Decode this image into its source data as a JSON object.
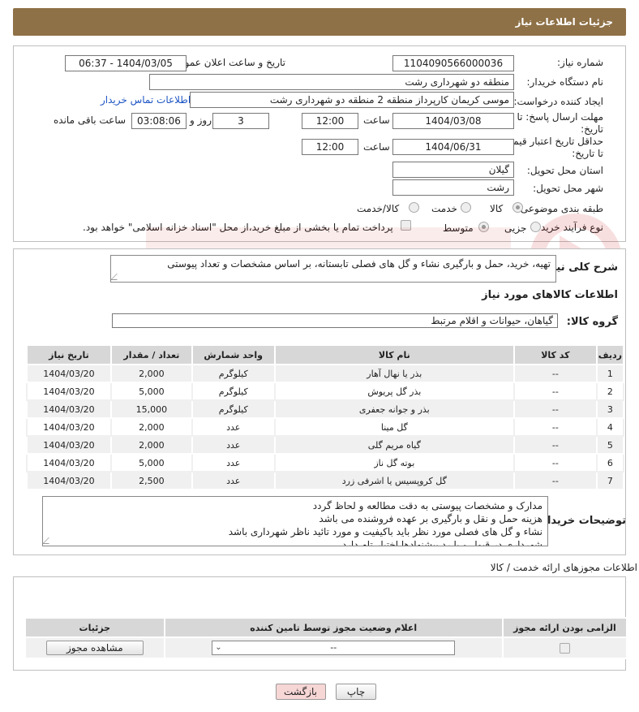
{
  "header": {
    "title": "جزئیات اطلاعات نیاز"
  },
  "form": {
    "need_number_label": "شماره نیاز:",
    "need_number": "1104090566000036",
    "announce_label": "تاریخ و ساعت اعلان عمومی:",
    "announce_value": "1404/03/05 - 06:37",
    "buyer_org_label": "نام دستگاه خریدار:",
    "buyer_org": "منطقه دو شهرداری رشت",
    "requester_label": "ایجاد کننده درخواست:",
    "requester": "موسی کریمان کارپرداز منطقه 2 منطقه دو شهرداری رشت",
    "contact_link": "اطلاعات تماس خریدار",
    "reply_deadline_label_1": "مهلت ارسال پاسخ: تا",
    "reply_deadline_label_2": "تاریخ:",
    "reply_date": "1404/03/08",
    "time_label": "ساعت",
    "reply_time": "12:00",
    "days_value": "3",
    "days_label": "روز و",
    "remaining_time": "03:08:06",
    "remaining_label": "ساعت باقی مانده",
    "price_validity_label_1": "حداقل تاریخ اعتبار قیمت:",
    "price_validity_label_2": "تا تاریخ:",
    "price_date": "1404/06/31",
    "price_time": "12:00",
    "province_label": "استان محل تحویل:",
    "province": "گیلان",
    "city_label": "شهر محل تحویل:",
    "city": "رشت",
    "category_label": "طبقه بندی موضوعی:",
    "category_options": [
      "کالا",
      "خدمت",
      "کالا/خدمت"
    ],
    "process_label": "نوع فرآیند خرید :",
    "process_options": [
      "جزیی",
      "متوسط"
    ],
    "treasury_note": "پرداخت تمام یا بخشی از مبلغ خرید،از محل \"اسناد خزانه اسلامی\" خواهد بود."
  },
  "description": {
    "label": "شرح کلی نیاز:",
    "text": "تهیه، خرید، حمل و بارگیری نشاء و گل های فصلی تابستانه، بر اساس مشخصات و تعداد پیوستی"
  },
  "goods": {
    "section_title": "اطلاعات کالاهای مورد نیاز",
    "group_label": "گروه کالا:",
    "group_value": "گیاهان، حیوانات و اقلام مرتبط",
    "columns": [
      "ردیف",
      "کد کالا",
      "نام کالا",
      "واحد شمارش",
      "تعداد / مقدار",
      "تاریخ نیاز"
    ],
    "rows": [
      [
        "1",
        "--",
        "بذر یا نهال آهار",
        "کیلوگرم",
        "2,000",
        "1404/03/20"
      ],
      [
        "2",
        "--",
        "بذر گل پریوش",
        "کیلوگرم",
        "5,000",
        "1404/03/20"
      ],
      [
        "3",
        "--",
        "بذر و جوانه جعفری",
        "کیلوگرم",
        "15,000",
        "1404/03/20"
      ],
      [
        "4",
        "--",
        "گل مینا",
        "عدد",
        "2,000",
        "1404/03/20"
      ],
      [
        "5",
        "--",
        "گیاه مریم گلی",
        "عدد",
        "2,000",
        "1404/03/20"
      ],
      [
        "6",
        "--",
        "بوته گل ناز",
        "عدد",
        "5,000",
        "1404/03/20"
      ],
      [
        "7",
        "--",
        "گل کروپسیس یا اشرفی زرد",
        "عدد",
        "2,500",
        "1404/03/20"
      ]
    ]
  },
  "buyer_notes": {
    "label": "توضیحات خریدار:",
    "lines": [
      "مدارک و مشخصات پیوستی به دقت مطالعه و لحاظ گردد",
      "هزینه حمل و نقل و بارگیری بر عهده فروشنده می باشد",
      "نشاء و گل های فصلی مورد نظر باید باکیفیت و  مورد تائید ناظر شهرداری باشد",
      "شهرداری در قبول و یا رد پیشنهادها اختیار تام دارد"
    ]
  },
  "licenses": {
    "section_title": "اطلاعات مجوزهای ارائه خدمت / کالا",
    "columns": [
      "الزامی بودن ارائه مجوز",
      "اعلام وضعیت مجوز توسط تامین کننده",
      "جزئیات"
    ],
    "status_value": "--",
    "view_button": "مشاهده مجوز"
  },
  "footer": {
    "print_button": "چاپ",
    "back_button": "بازگشت"
  },
  "colors": {
    "header": "#8f7147",
    "link": "#1d55c4",
    "back_button_bg": "#f7d6d6"
  }
}
